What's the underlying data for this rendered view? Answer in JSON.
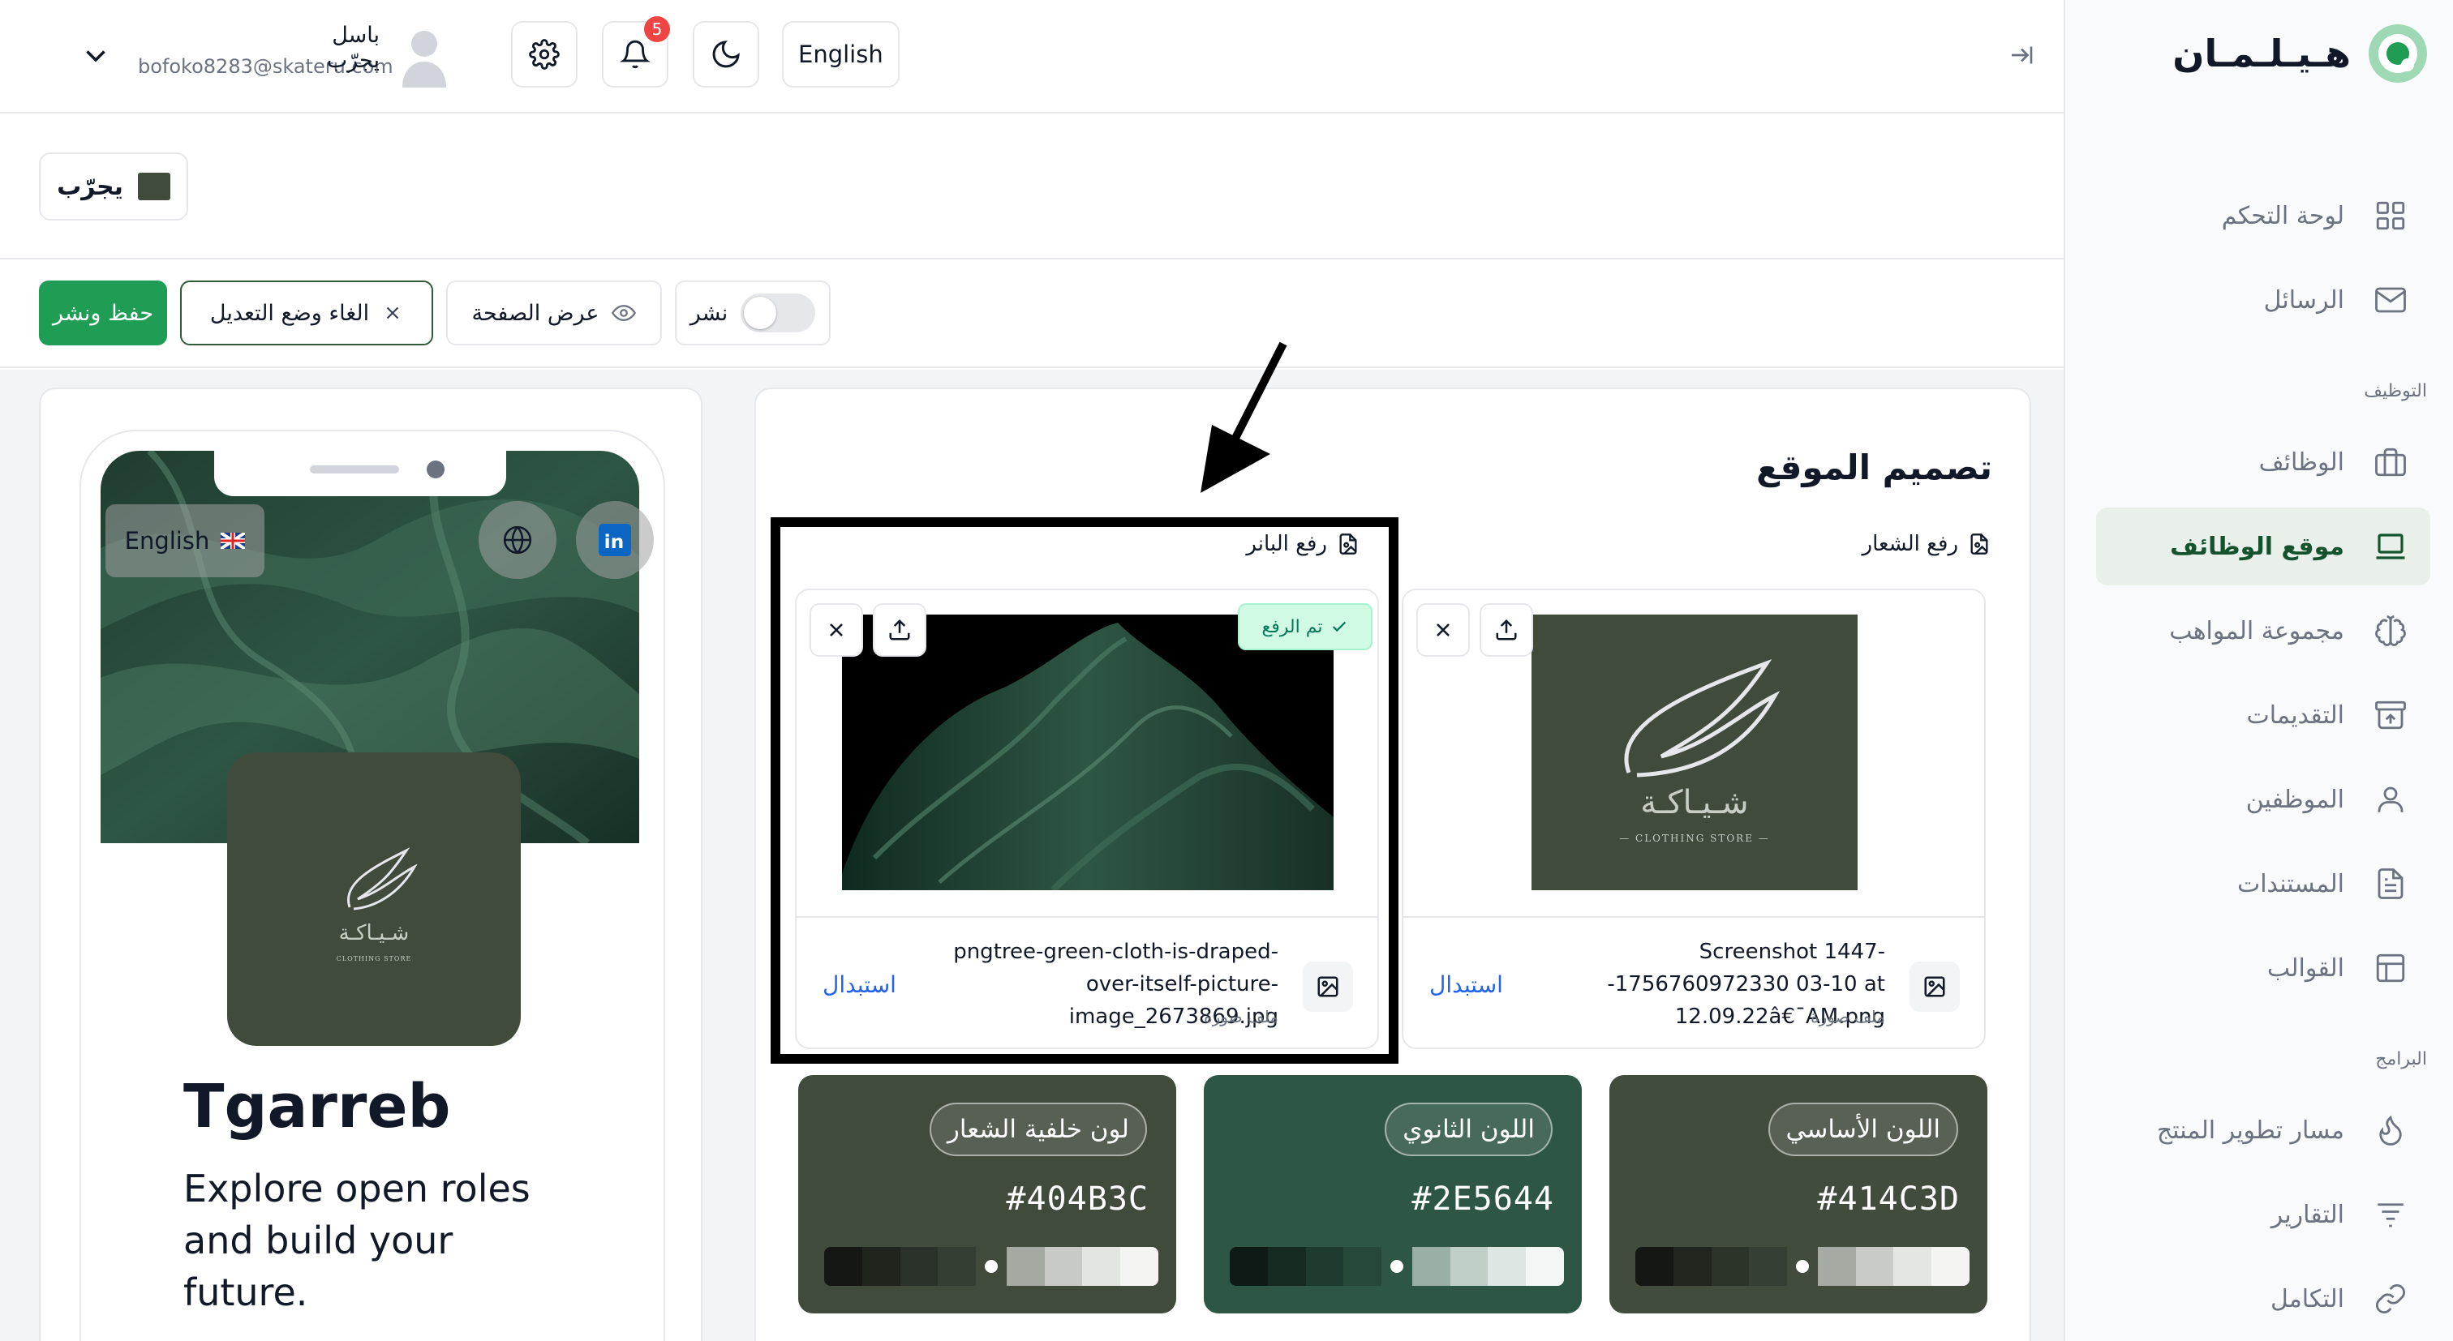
{
  "brand": {
    "logo_text": "هـيـلـمـان",
    "accent": "#1f9d55"
  },
  "sidebar": {
    "items": [
      {
        "label": "لوحة التحكم",
        "icon": "dashboard-icon"
      },
      {
        "label": "الرسائل",
        "icon": "mail-icon"
      },
      {
        "label": "الوظائف",
        "icon": "briefcase-icon"
      },
      {
        "label": "موقع الوظائف",
        "icon": "laptop-icon",
        "active": true
      },
      {
        "label": "مجموعة المواهب",
        "icon": "brain-icon"
      },
      {
        "label": "التقديمات",
        "icon": "archive-icon"
      },
      {
        "label": "الموظفين",
        "icon": "user-icon"
      },
      {
        "label": "المستندات",
        "icon": "document-icon"
      },
      {
        "label": "القوالب",
        "icon": "template-icon"
      },
      {
        "label": "مسار تطوير المنتج",
        "icon": "flame-icon"
      },
      {
        "label": "التقارير",
        "icon": "filter-icon"
      },
      {
        "label": "التكامل",
        "icon": "link-icon"
      }
    ],
    "sections": {
      "recruitment": "التوظيف",
      "programs": "البرامج"
    }
  },
  "topbar": {
    "language": "English",
    "notifications_count": "5",
    "user_name": "باسل يجرّب",
    "user_email": "bofoko8283@skateru.com"
  },
  "company": {
    "name": "يجرّب"
  },
  "actions": {
    "save": "حفظ ونشر",
    "cancel": "الغاء وضع التعديل",
    "preview": "عرض الصفحة",
    "publish": "نشر"
  },
  "phone": {
    "language": "English",
    "title": "Tgarreb",
    "subtitle": "Explore open roles and build your future.",
    "logo_text": "شـيـاكـة",
    "logo_sub": "CLOTHING STORE"
  },
  "design": {
    "title": "تصميم الموقع",
    "logo_upload": {
      "label": "رفع الشعار",
      "filename": "Screenshot 1447--1756760972330 03-10 at 12.09.22â€¯AM.png",
      "filetype": "ملف صورة",
      "replace": "استبدال"
    },
    "banner_upload": {
      "label": "رفع البانر",
      "filename": "pngtree-green-cloth-is-draped-over-itself-picture-image_2673869.jpg",
      "filetype": "ملف صورة",
      "replace": "استبدال",
      "status": "تم الرفع"
    },
    "colors": [
      {
        "name": "لون خلفية الشعار",
        "hex": "#404B3C"
      },
      {
        "name": "اللون الثانوي",
        "hex": "#2E5644"
      },
      {
        "name": "اللون الأساسي",
        "hex": "#414C3D"
      }
    ]
  }
}
